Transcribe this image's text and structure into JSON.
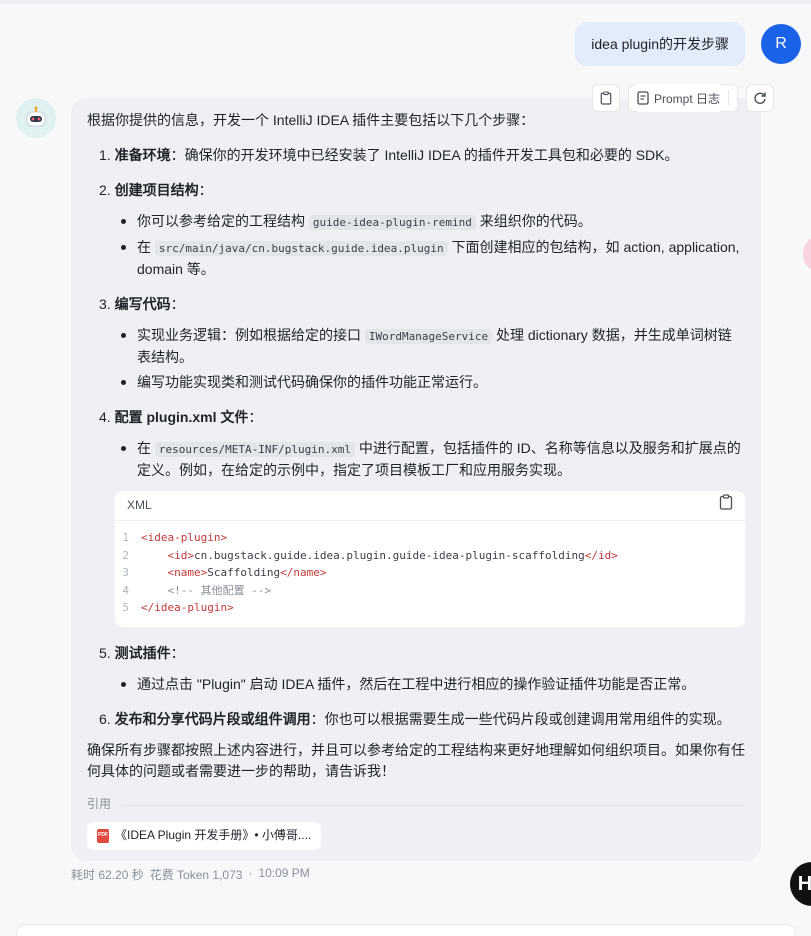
{
  "user_message": {
    "text": "idea plugin的开发步骤",
    "avatar_letter": "R"
  },
  "toolbar": {
    "prompt_log_label": "Prompt 日志"
  },
  "answer": {
    "intro": "根据你提供的信息，开发一个 IntelliJ IDEA 插件主要包括以下几个步骤：",
    "steps": [
      {
        "num": "1.",
        "title": "准备环境",
        "text": "：确保你的开发环境中已经安装了 IntelliJ IDEA 的插件开发工具包和必要的 SDK。"
      },
      {
        "num": "2.",
        "title": "创建项目结构",
        "text": "："
      },
      {
        "num": "3.",
        "title": "编写代码",
        "text": "："
      },
      {
        "num": "4.",
        "title": "配置 plugin.xml 文件",
        "text": "："
      },
      {
        "num": "5.",
        "title": "测试插件",
        "text": "："
      },
      {
        "num": "6.",
        "title": "发布和分享代码片段或组件调用",
        "text": "：你也可以根据需要生成一些代码片段或创建调用常用组件的实现。"
      }
    ],
    "step2_bullets": {
      "b1_pre": "你可以参考给定的工程结构 ",
      "b1_code": "guide-idea-plugin-remind",
      "b1_post": " 来组织你的代码。",
      "b2_pre": "在 ",
      "b2_code": "src/main/java/cn.bugstack.guide.idea.plugin",
      "b2_post": " 下面创建相应的包结构，如 action, application, domain 等。"
    },
    "step3_bullets": {
      "b1_pre": "实现业务逻辑：例如根据给定的接口 ",
      "b1_code": "IWordManageService",
      "b1_post": " 处理 dictionary 数据，并生成单词树链表结构。",
      "b2": "编写功能实现类和测试代码确保你的插件功能正常运行。"
    },
    "step4_bullets": {
      "b1_pre": "在 ",
      "b1_code": "resources/META-INF/plugin.xml",
      "b1_post": " 中进行配置，包括插件的 ID、名称等信息以及服务和扩展点的定义。例如，在给定的示例中，指定了项目模板工厂和应用服务实现。"
    },
    "code_block": {
      "language": "XML",
      "lines": [
        {
          "n": "1",
          "indent": "",
          "open": "<idea-plugin>",
          "content": "",
          "close": ""
        },
        {
          "n": "2",
          "indent": "    ",
          "open": "<id>",
          "content": "cn.bugstack.guide.idea.plugin.guide-idea-plugin-scaffolding",
          "close": "</id>"
        },
        {
          "n": "3",
          "indent": "    ",
          "open": "<name>",
          "content": "Scaffolding",
          "close": "</name>"
        },
        {
          "n": "4",
          "indent": "    ",
          "open": "",
          "content": "<!-- 其他配置 -->",
          "close": ""
        },
        {
          "n": "5",
          "indent": "",
          "open": "</idea-plugin>",
          "content": "",
          "close": ""
        }
      ]
    },
    "step5_bullets": {
      "b1": "通过点击 \"Plugin\" 启动 IDEA 插件，然后在工程中进行相应的操作验证插件功能是否正常。"
    },
    "conclusion": "确保所有步骤都按照上述内容进行，并且可以参考给定的工程结构来更好地理解如何组织项目。如果你有任何具体的问题或者需要进一步的帮助，请告诉我！",
    "refs_label": "引用",
    "ref_chip": "《IDEA Plugin 开发手册》• 小傅哥...."
  },
  "meta": {
    "time": "耗时 62.20 秒",
    "tokens": "花费 Token 1,073",
    "dot": "·",
    "clock": "10:09 PM"
  },
  "float_button": "H"
}
